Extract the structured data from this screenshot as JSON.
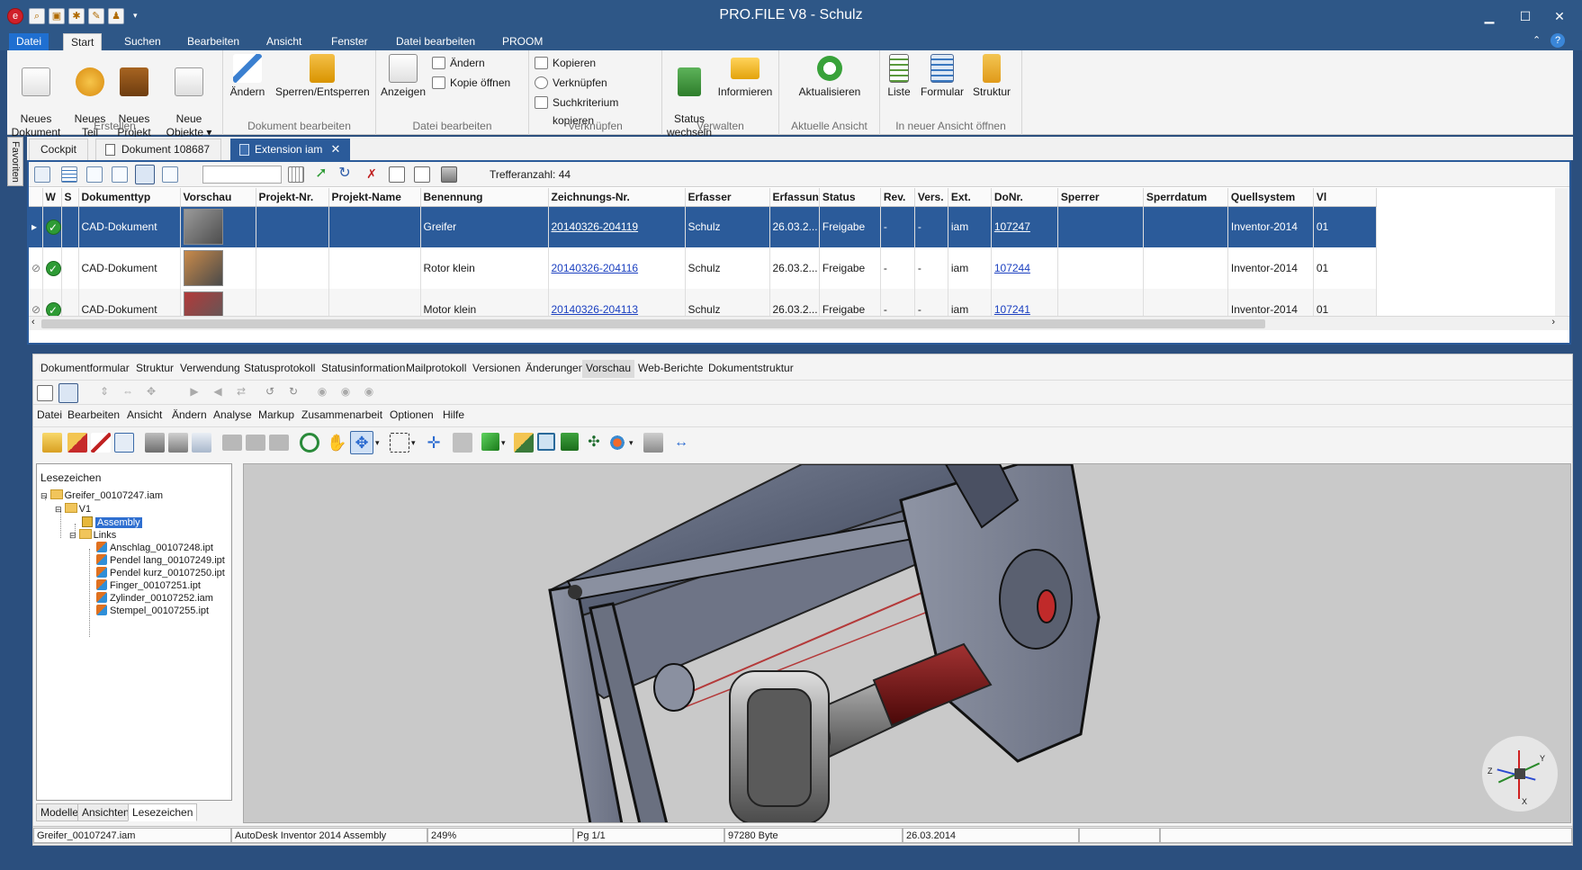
{
  "window": {
    "title": "PRO.FILE V8 - Schulz"
  },
  "ribbon_tabs": [
    "Datei",
    "Start",
    "Suchen",
    "Bearbeiten",
    "Ansicht",
    "Fenster",
    "Datei bearbeiten",
    "PROOM"
  ],
  "ribbon": {
    "erstellen": {
      "label": "Erstellen",
      "neues_dokument": "Neues\nDokument",
      "neues_teil": "Neues\nTeil",
      "neues_projekt": "Neues\nProjekt",
      "neue_objekte": "Neue\nObjekte ▾"
    },
    "dokument_bearbeiten": {
      "label": "Dokument bearbeiten",
      "aendern": "Ändern",
      "sperren": "Sperren/Entsperren"
    },
    "datei_bearbeiten": {
      "label": "Datei bearbeiten",
      "anzeigen": "Anzeigen",
      "aendern": "Ändern",
      "kopie_oeffnen": "Kopie öffnen"
    },
    "verknuepfen": {
      "label": "Verknüpfen",
      "kopieren": "Kopieren",
      "verknuepfen": "Verknüpfen",
      "suchkriterium": "Suchkriterium kopieren"
    },
    "verwalten": {
      "label": "Verwalten",
      "status_wechseln": "Status\nwechseln",
      "informieren": "Informieren"
    },
    "aktuelle_ansicht": {
      "label": "Aktuelle Ansicht",
      "aktualisieren": "Aktualisieren"
    },
    "neue_ansicht": {
      "label": "In neuer Ansicht öffnen",
      "liste": "Liste",
      "formular": "Formular",
      "struktur": "Struktur"
    }
  },
  "favoriten": "Favoriten",
  "doc_tabs": [
    "Cockpit",
    "Dokument 108687",
    "Extension iam"
  ],
  "grid": {
    "hits": "Trefferanzahl: 44",
    "columns": [
      "",
      "W",
      "S",
      "Dokumenttyp",
      "Vorschau",
      "Projekt-Nr.",
      "Projekt-Name",
      "Benennung",
      "Zeichnungs-Nr.",
      "Erfasser",
      "Erfassun",
      "Status",
      "Rev.",
      "Vers.",
      "Ext.",
      "DoNr.",
      "Sperrer",
      "Sperrdatum",
      "Quellsystem",
      "Vl"
    ],
    "rows": [
      {
        "dokumenttyp": "CAD-Dokument",
        "benennung": "Greifer",
        "zeichnungs_nr": "20140326-204119",
        "erfasser": "Schulz",
        "erfassung": "26.03.2...",
        "status": "Freigabe",
        "rev": "-",
        "vers": "-",
        "ext": "iam",
        "donr": "107247",
        "quellsystem": "Inventor-2014",
        "vl": "01"
      },
      {
        "dokumenttyp": "CAD-Dokument",
        "benennung": "Rotor klein",
        "zeichnungs_nr": "20140326-204116",
        "erfasser": "Schulz",
        "erfassung": "26.03.2...",
        "status": "Freigabe",
        "rev": "-",
        "vers": "-",
        "ext": "iam",
        "donr": "107244",
        "quellsystem": "Inventor-2014",
        "vl": "01"
      },
      {
        "dokumenttyp": "CAD-Dokument",
        "benennung": "Motor klein",
        "zeichnungs_nr": "20140326-204113",
        "erfasser": "Schulz",
        "erfassung": "26.03.2...",
        "status": "Freigabe",
        "rev": "-",
        "vers": "-",
        "ext": "iam",
        "donr": "107241",
        "quellsystem": "Inventor-2014",
        "vl": "01"
      }
    ]
  },
  "sub_tabs": [
    "Dokumentformular",
    "Struktur",
    "Verwendung",
    "Statusprotokoll",
    "Statusinformation",
    "Mailprotokoll",
    "Versionen",
    "Änderungen",
    "Vorschau",
    "Web-Berichte",
    "Dokumentstruktur"
  ],
  "viewer_menu": [
    "Datei",
    "Bearbeiten",
    "Ansicht",
    "Ändern",
    "Analyse",
    "Markup",
    "Zusammenarbeit",
    "Optionen",
    "Hilfe"
  ],
  "tree": {
    "header": "Lesezeichen",
    "root": "Greifer_00107247.iam",
    "v1": "V1",
    "assembly": "Assembly",
    "links": "Links",
    "items": [
      "Anschlag_00107248.ipt",
      "Pendel lang_00107249.ipt",
      "Pendel kurz_00107250.ipt",
      "Finger_00107251.ipt",
      "Zylinder_00107252.iam",
      "Stempel_00107255.ipt"
    ]
  },
  "tree_tabs": [
    "Modelle",
    "Ansichten",
    "Lesezeichen"
  ],
  "statusbar": [
    "Greifer_00107247.iam",
    "AutoDesk Inventor 2014 Assembly",
    "249%",
    "Pg 1/1",
    "97280 Byte",
    "26.03.2014"
  ],
  "triad": {
    "x": "X",
    "y": "Y",
    "z": "Z"
  }
}
